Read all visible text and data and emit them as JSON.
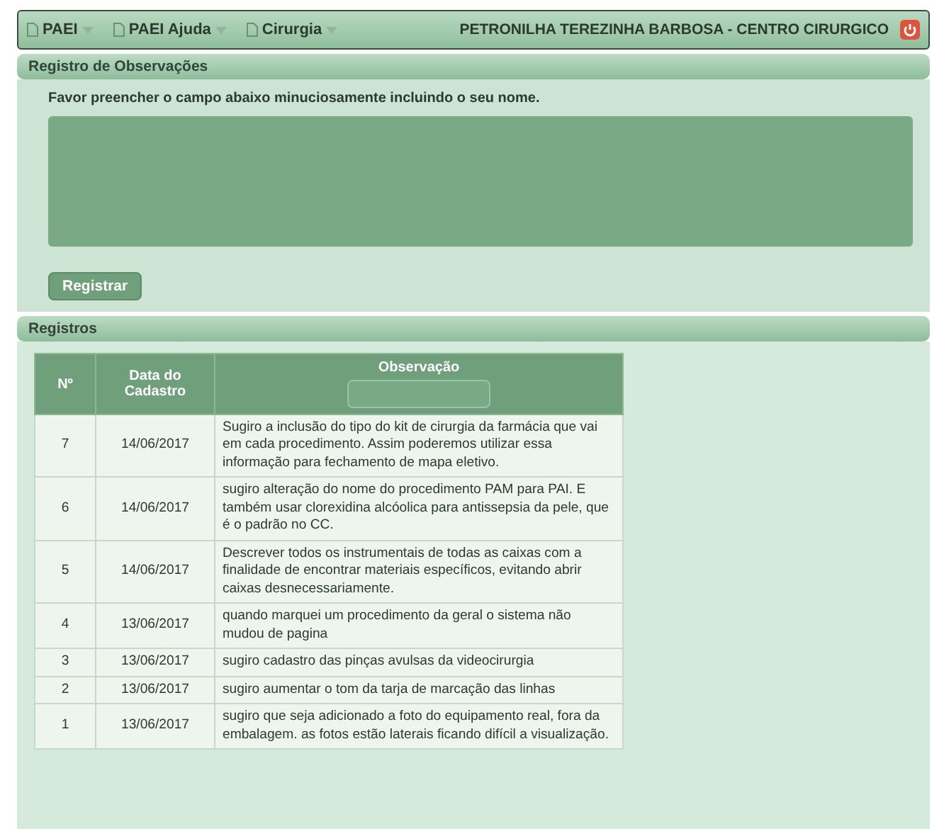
{
  "menu": [
    {
      "label": "PAEI"
    },
    {
      "label": "PAEI Ajuda"
    },
    {
      "label": "Cirurgia"
    }
  ],
  "user": "PETRONILHA TEREZINHA BARBOSA - CENTRO CIRURGICO",
  "form_panel": {
    "title": "Registro de Observações",
    "instruction": "Favor preencher o campo abaixo minuciosamente incluindo o seu nome.",
    "button": "Registrar"
  },
  "records_panel": {
    "title": "Registros",
    "columns": [
      "Nº",
      "Data do Cadastro",
      "Observação"
    ],
    "rows": [
      {
        "no": "7",
        "date": "14/06/2017",
        "text": "Sugiro a inclusão do tipo do kit de cirurgia da farmácia que vai em cada procedimento. Assim poderemos utilizar essa informação para fechamento de mapa eletivo."
      },
      {
        "no": "6",
        "date": "14/06/2017",
        "text": "sugiro alteração do nome do procedimento PAM para PAI. E também usar clorexidina alcóolica para antissepsia da pele, que é o padrão no CC."
      },
      {
        "no": "5",
        "date": "14/06/2017",
        "text": "Descrever todos os instrumentais de todas as caixas com a finalidade de encontrar materiais específicos, evitando abrir caixas desnecessariamente."
      },
      {
        "no": "4",
        "date": "13/06/2017",
        "text": "quando marquei um procedimento da geral o sistema não mudou de pagina"
      },
      {
        "no": "3",
        "date": "13/06/2017",
        "text": "sugiro cadastro das pinças avulsas da videocirurgia"
      },
      {
        "no": "2",
        "date": "13/06/2017",
        "text": "sugiro aumentar o tom da tarja de marcação das linhas"
      },
      {
        "no": "1",
        "date": "13/06/2017",
        "text": "sugiro que seja adicionado a foto do equipamento real, fora da embalagem. as fotos estão laterais ficando difícil a visualização."
      }
    ]
  }
}
